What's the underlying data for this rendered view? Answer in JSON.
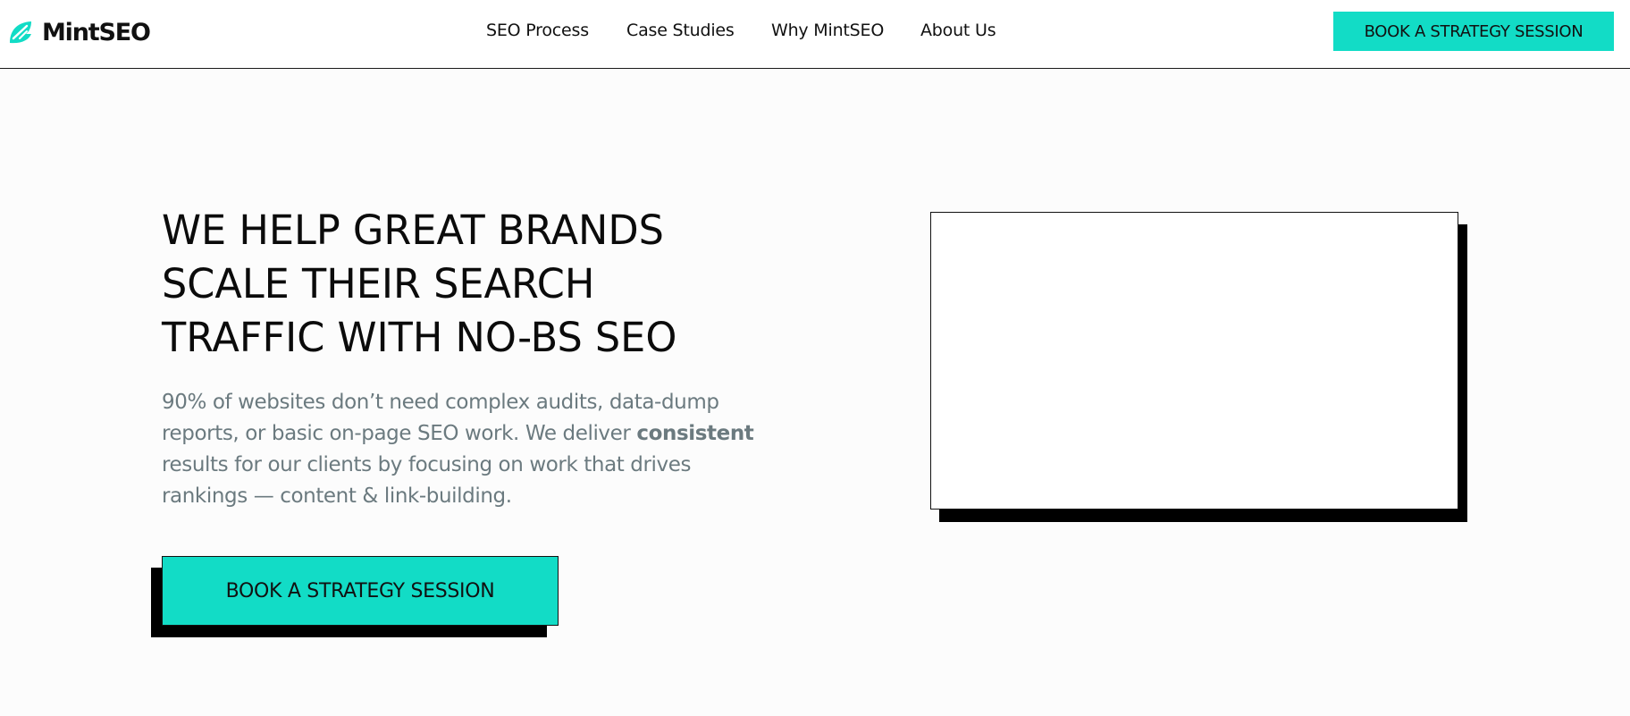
{
  "brand": {
    "name": "MintSEO",
    "accent_color": "#12dcc6",
    "logo_icon": "mint-leaf-icon"
  },
  "nav": {
    "items": [
      {
        "label": "SEO Process"
      },
      {
        "label": "Case Studies"
      },
      {
        "label": "Why MintSEO"
      },
      {
        "label": "About Us"
      }
    ],
    "cta_label": "BOOK A STRATEGY SESSION"
  },
  "hero": {
    "title_lines": [
      "WE HELP GREAT BRANDS",
      "SCALE THEIR SEARCH",
      "TRAFFIC WITH NO-BS SEO"
    ],
    "description": {
      "line1": "90% of websites don’t need complex audits, data-dump",
      "line2_before": "reports, or basic on-page SEO work. We deliver ",
      "line2_bold": "consistent",
      "line3": "results for our clients by focusing on work that drives",
      "line4": "rankings — content & link-building."
    },
    "cta_label": "BOOK A STRATEGY SESSION"
  }
}
